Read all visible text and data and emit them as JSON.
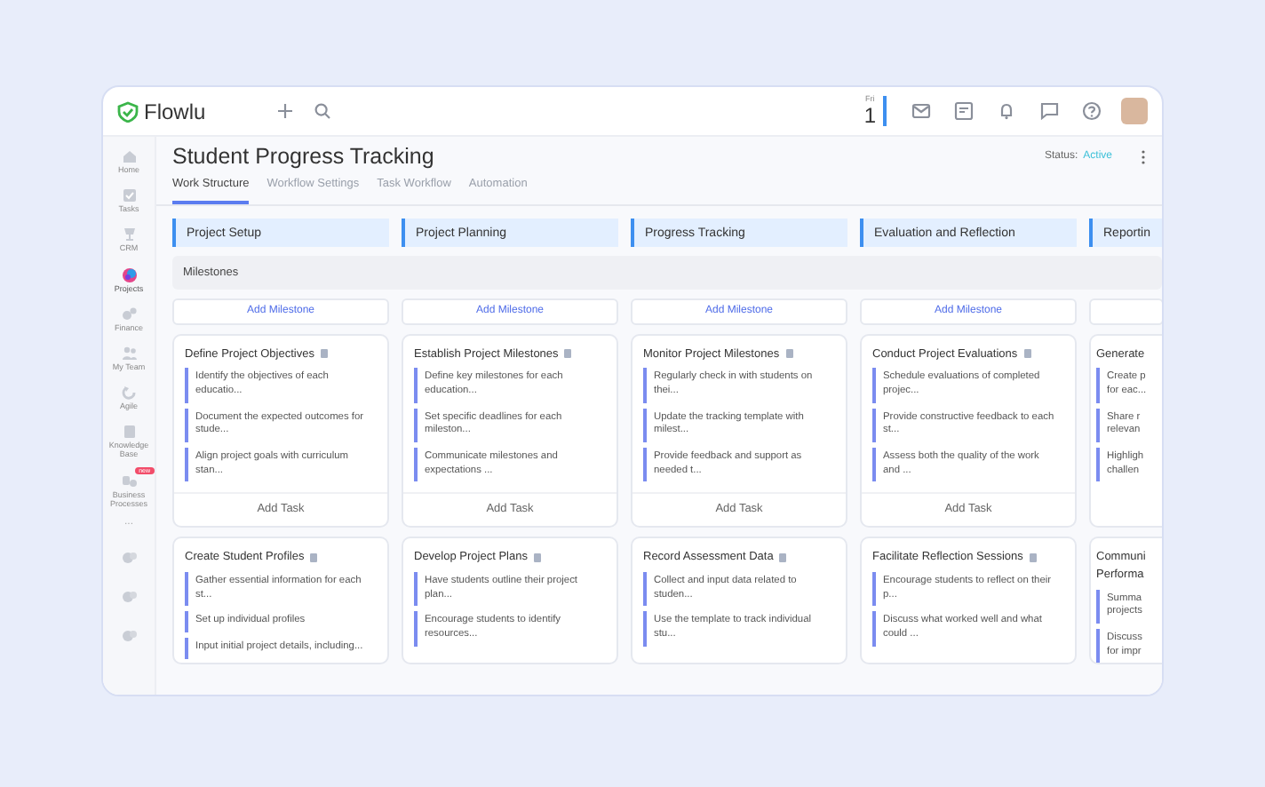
{
  "app": {
    "name": "Flowlu"
  },
  "topbar": {
    "day": "Fri",
    "date": "1"
  },
  "sidebar": [
    {
      "label": "Home",
      "selected": false
    },
    {
      "label": "Tasks",
      "selected": false
    },
    {
      "label": "CRM",
      "selected": false
    },
    {
      "label": "Projects",
      "selected": true
    },
    {
      "label": "Finance",
      "selected": false
    },
    {
      "label": "My Team",
      "selected": false
    },
    {
      "label": "Agile",
      "selected": false
    },
    {
      "label": "Knowledge Base",
      "selected": false
    },
    {
      "label": "Business Processes",
      "selected": false,
      "badge": "new"
    }
  ],
  "sidebar_more": "...",
  "project": {
    "title": "Student Progress Tracking",
    "status_label": "Status:",
    "status": "Active"
  },
  "tabs": [
    {
      "label": "Work Structure",
      "selected": true
    },
    {
      "label": "Workflow Settings",
      "selected": false
    },
    {
      "label": "Task Workflow",
      "selected": false
    },
    {
      "label": "Automation",
      "selected": false
    }
  ],
  "milestones_label": "Milestones",
  "columns": [
    {
      "title": "Project Setup",
      "add_milestone": "Add Milestone",
      "cards": [
        {
          "title": "Define Project Objectives",
          "tasks": [
            "Identify the objectives of each educatio...",
            "Document the expected outcomes for stude...",
            "Align project goals with curriculum stan..."
          ],
          "add_task": "Add Task"
        },
        {
          "title": "Create Student Profiles",
          "tasks": [
            "Gather essential information for each st...",
            "Set up individual profiles",
            "Input initial project details, including..."
          ]
        }
      ]
    },
    {
      "title": "Project Planning",
      "add_milestone": "Add Milestone",
      "cards": [
        {
          "title": "Establish Project Milestones",
          "tasks": [
            "Define key milestones for each education...",
            "Set specific deadlines for each mileston...",
            "Communicate milestones and expectations ..."
          ],
          "add_task": "Add Task"
        },
        {
          "title": "Develop Project Plans",
          "tasks": [
            "Have students outline their project plan...",
            "Encourage students to identify resources..."
          ]
        }
      ]
    },
    {
      "title": "Progress Tracking",
      "add_milestone": "Add Milestone",
      "cards": [
        {
          "title": "Monitor Project Milestones",
          "tasks": [
            "Regularly check in with students on thei...",
            "Update the tracking template with milest...",
            "Provide feedback and support as needed t..."
          ],
          "add_task": "Add Task"
        },
        {
          "title": "Record Assessment Data",
          "tasks": [
            "Collect and input data related to studen...",
            "Use the template to track individual stu..."
          ]
        }
      ]
    },
    {
      "title": "Evaluation and Reflection",
      "add_milestone": "Add Milestone",
      "cards": [
        {
          "title": "Conduct Project Evaluations",
          "tasks": [
            "Schedule evaluations of completed projec...",
            "Provide constructive feedback to each st...",
            "Assess both the quality of the work and ..."
          ],
          "add_task": "Add Task"
        },
        {
          "title": "Facilitate Reflection Sessions",
          "tasks": [
            "Encourage students to reflect on their p...",
            "Discuss what worked well and what could ..."
          ]
        }
      ]
    },
    {
      "title": "Reportin",
      "cards": [
        {
          "title": "Generate",
          "tasks": [
            "Create p for eac...",
            "Share r relevan",
            "Highligh challen"
          ]
        },
        {
          "title": "Communi Performa",
          "tasks": [
            "Summa projects",
            "Discuss for impr"
          ]
        }
      ]
    }
  ]
}
